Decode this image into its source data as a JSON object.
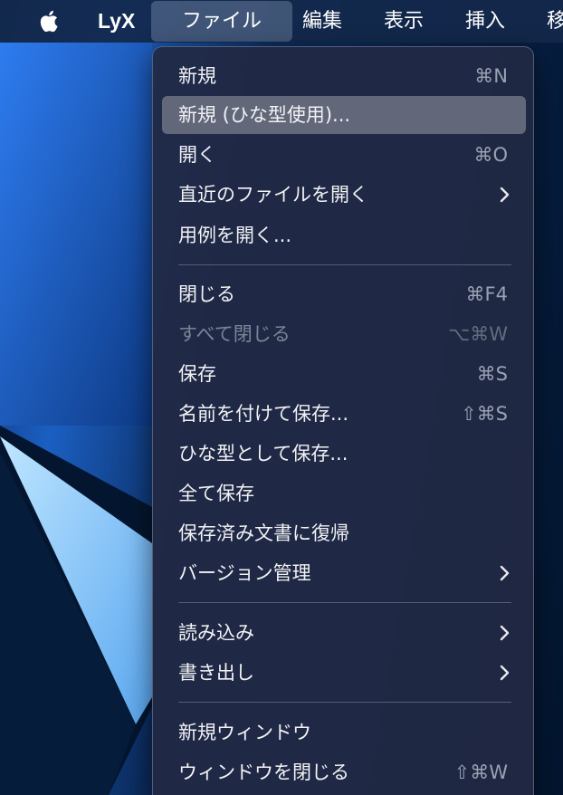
{
  "menubar": {
    "app_name": "LyX",
    "items": [
      "ファイル",
      "編集",
      "表示",
      "挿入",
      "移"
    ]
  },
  "file_menu": {
    "groups": [
      [
        {
          "label": "新規",
          "shortcut": "⌘N"
        },
        {
          "label": "新規 (ひな型使用)...",
          "shortcut": "",
          "highlighted": true
        },
        {
          "label": "開く",
          "shortcut": "⌘O"
        },
        {
          "label": "直近のファイルを開く",
          "submenu": true
        },
        {
          "label": "用例を開く..."
        }
      ],
      [
        {
          "label": "閉じる",
          "shortcut": "⌘F4"
        },
        {
          "label": "すべて閉じる",
          "shortcut": "⌥⌘W",
          "disabled": true
        },
        {
          "label": "保存",
          "shortcut": "⌘S"
        },
        {
          "label": "名前を付けて保存...",
          "shortcut": "⇧⌘S"
        },
        {
          "label": "ひな型として保存..."
        },
        {
          "label": "全て保存"
        },
        {
          "label": "保存済み文書に復帰"
        },
        {
          "label": "バージョン管理",
          "submenu": true
        }
      ],
      [
        {
          "label": "読み込み",
          "submenu": true
        },
        {
          "label": "書き出し",
          "submenu": true
        }
      ],
      [
        {
          "label": "新規ウィンドウ"
        },
        {
          "label": "ウィンドウを閉じる",
          "shortcut": "⇧⌘W"
        }
      ]
    ]
  },
  "colors": {
    "menu_bg": "#212944",
    "highlight": "#6e7382",
    "text": "#f2f2f5",
    "shortcut": "#9aa1b2",
    "disabled": "#7d8496"
  }
}
